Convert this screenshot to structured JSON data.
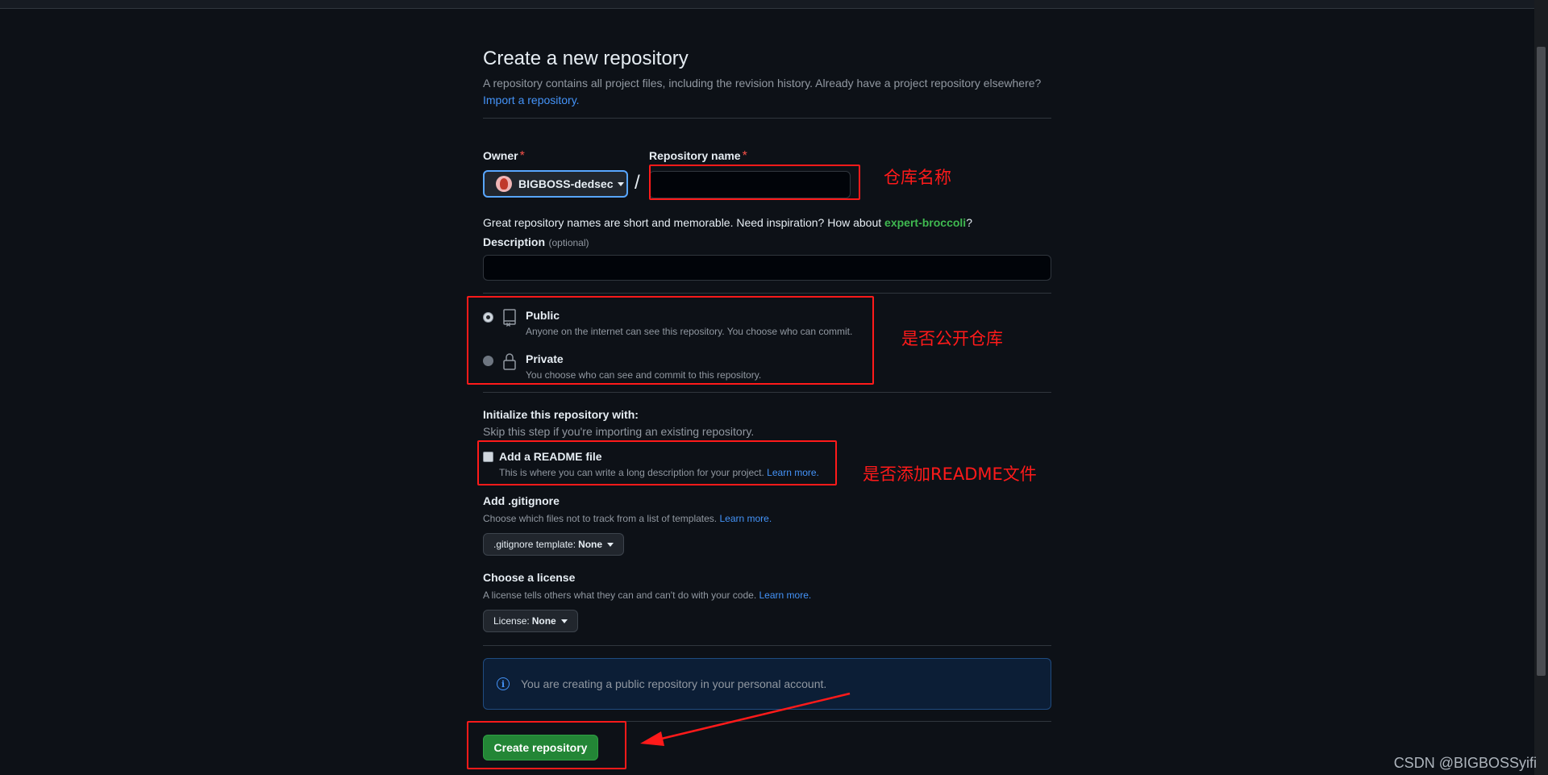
{
  "page": {
    "title": "Create a new repository",
    "subtitle": "A repository contains all project files, including the revision history. Already have a project repository elsewhere?",
    "import_link": "Import a repository."
  },
  "owner": {
    "label": "Owner",
    "required_mark": "*",
    "value": "BIGBOSS-dedsec"
  },
  "repo_name": {
    "label": "Repository name",
    "required_mark": "*",
    "value": "",
    "separator": "/"
  },
  "hint": {
    "text": "Great repository names are short and memorable. Need inspiration? How about ",
    "suggestion": "expert-broccoli",
    "end": "?"
  },
  "description": {
    "label": "Description",
    "optional": "(optional)",
    "value": ""
  },
  "visibility": {
    "public": {
      "title": "Public",
      "desc": "Anyone on the internet can see this repository. You choose who can commit.",
      "checked": true
    },
    "private": {
      "title": "Private",
      "desc": "You choose who can see and commit to this repository.",
      "checked": false
    }
  },
  "init": {
    "title": "Initialize this repository with:",
    "subtitle": "Skip this step if you're importing an existing repository.",
    "readme_title": "Add a README file",
    "readme_desc": "This is where you can write a long description for your project.",
    "readme_link": "Learn more.",
    "readme_checked": false
  },
  "gitignore": {
    "title": "Add .gitignore",
    "desc": "Choose which files not to track from a list of templates.",
    "link": "Learn more.",
    "select_label": ".gitignore template:",
    "select_value": "None"
  },
  "license": {
    "title": "Choose a license",
    "desc": "A license tells others what they can and can't do with your code.",
    "link": "Learn more.",
    "select_label": "License:",
    "select_value": "None"
  },
  "notice": {
    "text": "You are creating a public repository in your personal account."
  },
  "create_button": "Create repository",
  "annotations": {
    "repo_name": "仓库名称",
    "visibility": "是否公开仓库",
    "readme": "是否添加README文件"
  },
  "watermark": "CSDN @BIGBOSSyifi",
  "colors": {
    "background": "#0d1117",
    "accent_link": "#4493f8",
    "primary_button": "#238636",
    "annotation_red": "#ff1a1a",
    "suggestion_green": "#3fb950"
  }
}
